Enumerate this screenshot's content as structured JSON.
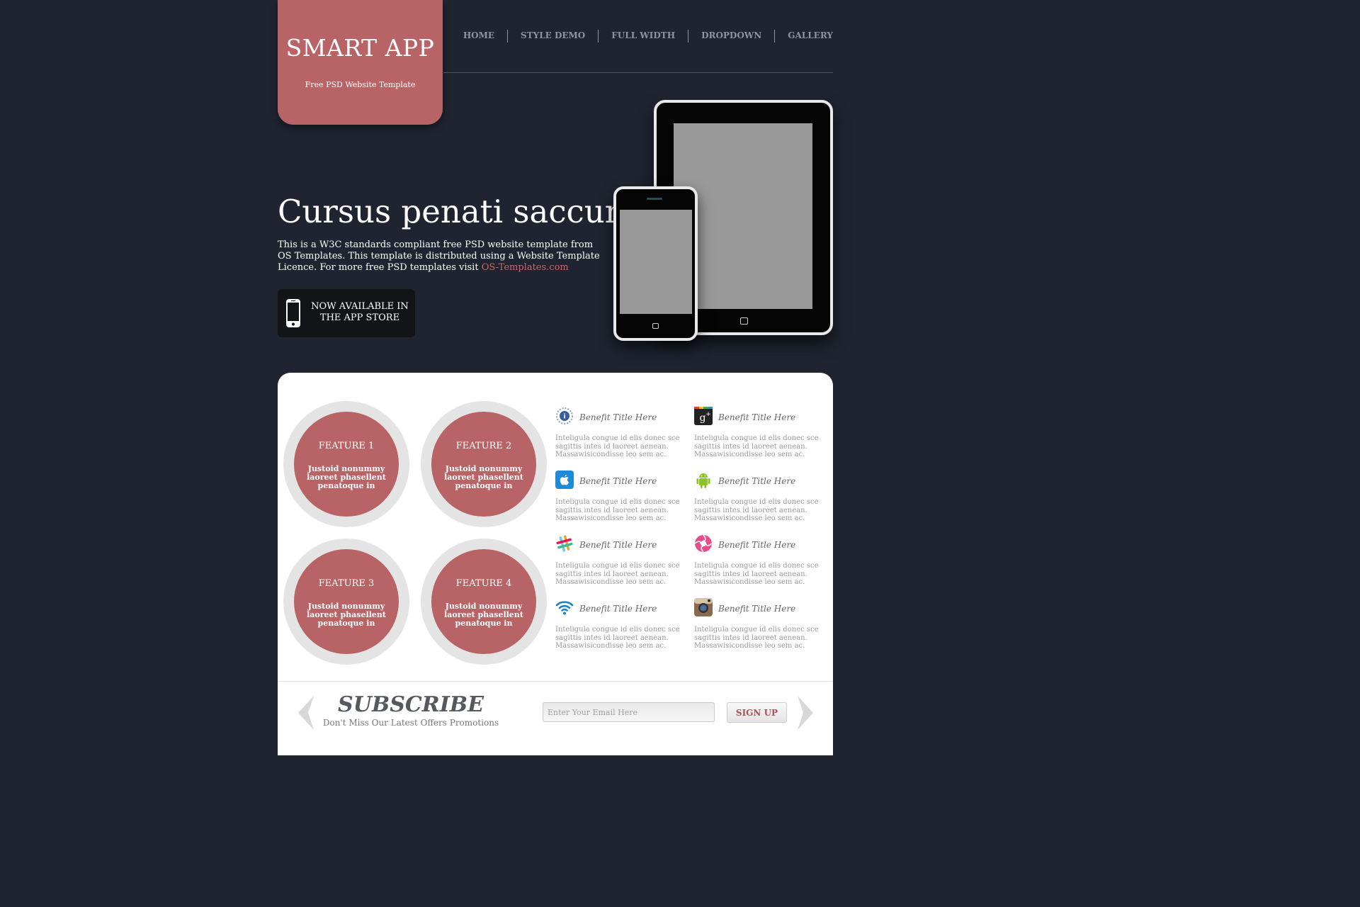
{
  "header": {
    "logo_title": "SMART APP",
    "logo_subtitle": "Free PSD Website Template",
    "nav": [
      "HOME",
      "STYLE DEMO",
      "FULL WIDTH",
      "DROPDOWN",
      "GALLERY"
    ]
  },
  "hero": {
    "title": "Cursus penati saccum.",
    "text": "This is a W3C standards compliant free PSD website template from OS Templates. This template is distributed using a Website Template Licence. For more free PSD templates visit",
    "link_text": "OS-Templates.com",
    "cta_line1": "NOW AVAILABLE IN",
    "cta_line2": "THE APP STORE"
  },
  "features": [
    {
      "title": "FEATURE 1",
      "text": "Justoid nonummy laoreet phasellent penatoque in"
    },
    {
      "title": "FEATURE 2",
      "text": "Justoid nonummy laoreet phasellent penatoque in"
    },
    {
      "title": "FEATURE 3",
      "text": "Justoid nonummy laoreet phasellent penatoque in"
    },
    {
      "title": "FEATURE 4",
      "text": "Justoid nonummy laoreet phasellent penatoque in"
    }
  ],
  "benefits": [
    {
      "icon": "badge-icon",
      "title": "Benefit Title Here",
      "text": "Inteligula congue id elis donec sce sagittis intes id laoreet aenean. Massawisicondisse leo sem ac."
    },
    {
      "icon": "google-plus-icon",
      "title": "Benefit Title Here",
      "text": "Inteligula congue id elis donec sce sagittis intes id laoreet aenean. Massawisicondisse leo sem ac."
    },
    {
      "icon": "apple-icon",
      "title": "Benefit Title Here",
      "text": "Inteligula congue id elis donec sce sagittis intes id laoreet aenean. Massawisicondisse leo sem ac."
    },
    {
      "icon": "android-icon",
      "title": "Benefit Title Here",
      "text": "Inteligula congue id elis donec sce sagittis intes id laoreet aenean. Massawisicondisse leo sem ac."
    },
    {
      "icon": "slack-icon",
      "title": "Benefit Title Here",
      "text": "Inteligula congue id elis donec sce sagittis intes id laoreet aenean. Massawisicondisse leo sem ac."
    },
    {
      "icon": "dribbble-icon",
      "title": "Benefit Title Here",
      "text": "Inteligula congue id elis donec sce sagittis intes id laoreet aenean. Massawisicondisse leo sem ac."
    },
    {
      "icon": "wifi-icon",
      "title": "Benefit Title Here",
      "text": "Inteligula congue id elis donec sce sagittis intes id laoreet aenean. Massawisicondisse leo sem ac."
    },
    {
      "icon": "instagram-icon",
      "title": "Benefit Title Here",
      "text": "Inteligula congue id elis donec sce sagittis intes id laoreet aenean. Massawisicondisse leo sem ac."
    }
  ],
  "subscribe": {
    "title": "SUBSCRIBE",
    "subtitle": "Don't Miss Our Latest Offers Promotions",
    "email_placeholder": "Enter Your Email Here",
    "button_label": "SIGN UP"
  },
  "colors": {
    "background": "#1f2430",
    "accent": "#b86365",
    "panel": "#ffffff"
  }
}
